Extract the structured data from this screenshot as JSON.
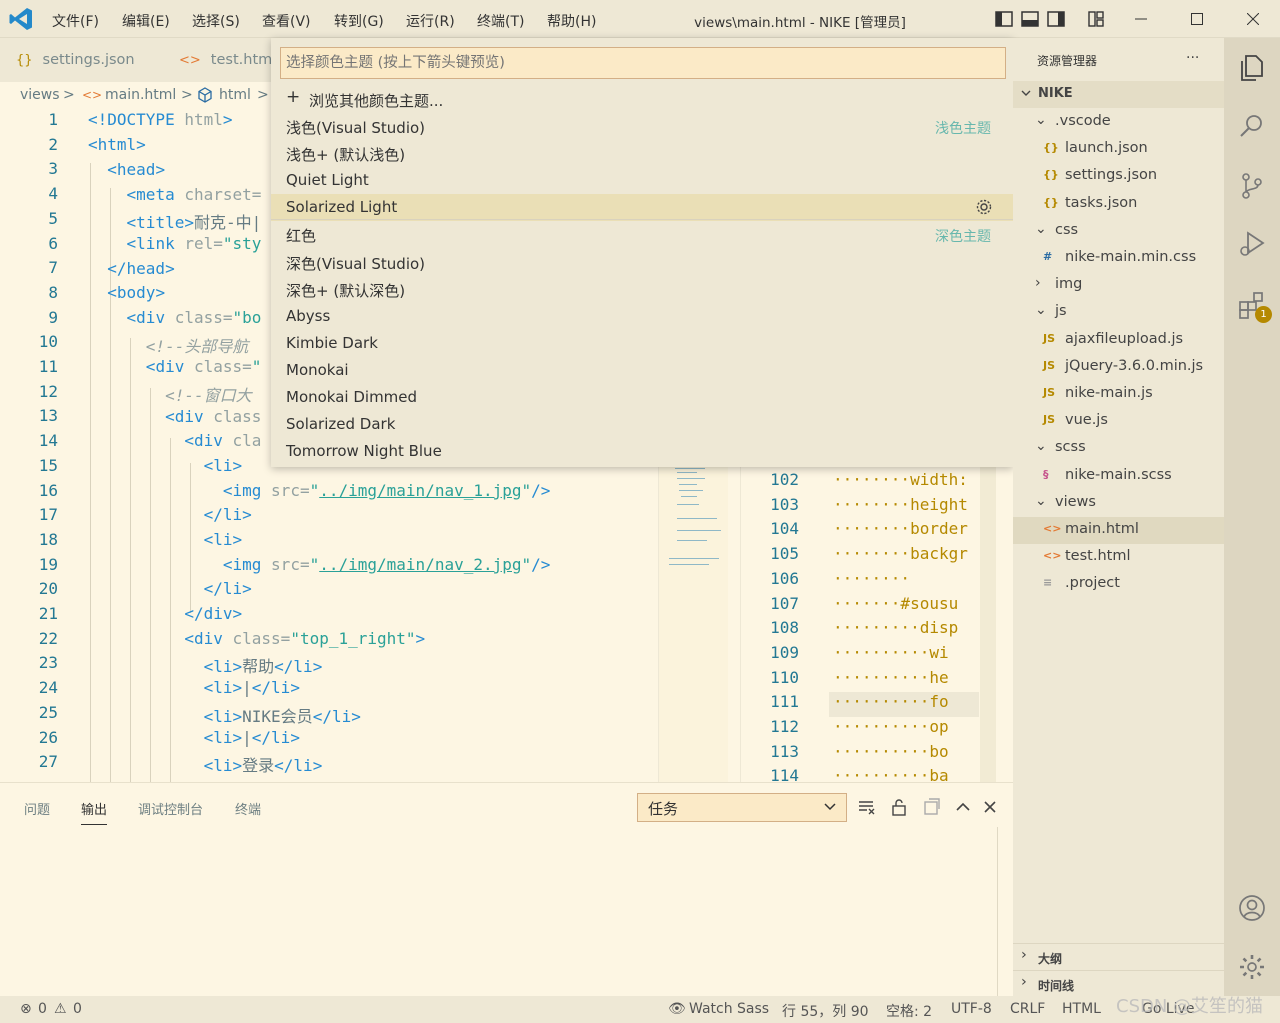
{
  "titlebar": {
    "menus": [
      "文件(F)",
      "编辑(E)",
      "选择(S)",
      "查看(V)",
      "转到(G)",
      "运行(R)",
      "终端(T)",
      "帮助(H)"
    ],
    "title": "views\\main.html - NIKE [管理员]"
  },
  "tabs": [
    {
      "label": "settings.json",
      "icon": "{}"
    },
    {
      "label": "test.html",
      "icon": "<>"
    }
  ],
  "breadcrumb": [
    "views",
    ">",
    "main.html",
    ">",
    "html",
    ">"
  ],
  "editor": {
    "line_numbers": [
      "1",
      "2",
      "3",
      "4",
      "5",
      "6",
      "7",
      "8",
      "9",
      "10",
      "11",
      "12",
      "13",
      "14",
      "15",
      "16",
      "17",
      "18",
      "19",
      "20",
      "21",
      "22",
      "23",
      "24",
      "25",
      "26",
      "27"
    ],
    "right_line_numbers": [
      "102",
      "103",
      "104",
      "105",
      "106",
      "107",
      "108",
      "109",
      "110",
      "111",
      "112",
      "113",
      "114"
    ],
    "right_code": [
      "········width:",
      "········height",
      "········border",
      "········backgr",
      "········",
      "·······#sousu",
      "·········disp",
      "··········wi",
      "··········he",
      "··········fo",
      "··········op",
      "··········bo",
      "··········ba"
    ]
  },
  "quickpick": {
    "placeholder": "选择颜色主题 (按上下箭头键预览)",
    "browse": "浏览其他颜色主题...",
    "light_group": "浅色主题",
    "dark_group": "深色主题",
    "items": [
      "浅色(Visual Studio)",
      "浅色+ (默认浅色)",
      "Quiet Light",
      "Solarized Light",
      "红色",
      "深色(Visual Studio)",
      "深色+ (默认深色)",
      "Abyss",
      "Kimbie Dark",
      "Monokai",
      "Monokai Dimmed",
      "Solarized Dark",
      "Tomorrow Night Blue"
    ],
    "selected": "Solarized Light"
  },
  "panel": {
    "tabs": [
      "问题",
      "输出",
      "调试控制台",
      "终端"
    ],
    "active_tab": "输出",
    "select_value": "任务"
  },
  "sidebar": {
    "title": "资源管理器",
    "more": "···",
    "root": "NIKE",
    "items": [
      {
        "label": ".vscode",
        "icon": "chevron-down"
      },
      {
        "label": "launch.json",
        "icon": "{}"
      },
      {
        "label": "settings.json",
        "icon": "{}"
      },
      {
        "label": "tasks.json",
        "icon": "{}"
      },
      {
        "label": "css",
        "icon": "chevron-down"
      },
      {
        "label": "nike-main.min.css",
        "icon": "#"
      },
      {
        "label": "img",
        "icon": "chevron-right"
      },
      {
        "label": "js",
        "icon": "chevron-down"
      },
      {
        "label": "ajaxfileupload.js",
        "icon": "JS"
      },
      {
        "label": "jQuery-3.6.0.min.js",
        "icon": "JS"
      },
      {
        "label": "nike-main.js",
        "icon": "JS"
      },
      {
        "label": "vue.js",
        "icon": "JS"
      },
      {
        "label": "scss",
        "icon": "chevron-down"
      },
      {
        "label": "nike-main.scss",
        "icon": "scss"
      },
      {
        "label": "views",
        "icon": "chevron-down"
      },
      {
        "label": "main.html",
        "icon": "<>"
      },
      {
        "label": "test.html",
        "icon": "<>"
      },
      {
        "label": ".project",
        "icon": "≡"
      }
    ],
    "outline": "大纲",
    "timeline": "时间线",
    "badge": "1"
  },
  "status": {
    "errors": "0",
    "warnings": "0",
    "watch_sass": "Watch Sass",
    "position": "行 55，列 90",
    "spaces": "空格: 2",
    "encoding": "UTF-8",
    "eol": "CRLF",
    "language": "HTML",
    "go_live": "Go Live",
    "watermark": "CSDN @艾笙的猫"
  },
  "colors": {
    "background": "#fdf6e3",
    "sidebar": "#eee8d5",
    "tag": "#268bd2",
    "string": "#2aa198",
    "accent": "#b58900"
  }
}
